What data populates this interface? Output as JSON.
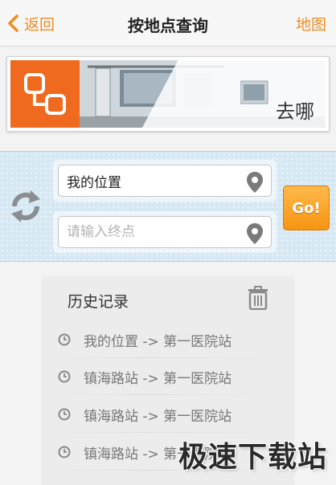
{
  "navbar": {
    "back_label": "返回",
    "title": "按地点查询",
    "map_label": "地图",
    "accent_color": "#f08c1e"
  },
  "banner": {
    "text": "去哪",
    "logo_color": "#ef6a1f"
  },
  "search": {
    "start_value": "我的位置",
    "end_placeholder": "请输入终点",
    "go_label": "Go!"
  },
  "history": {
    "title": "历史记录",
    "items": [
      {
        "label": "我的位置 -> 第一医院站"
      },
      {
        "label": "镇海路站 -> 第一医院站"
      },
      {
        "label": "镇海路站 -> 第一医院站"
      },
      {
        "label": "镇海路站 -> 第一医院站"
      }
    ]
  },
  "watermark": {
    "text": "极速下载站"
  }
}
